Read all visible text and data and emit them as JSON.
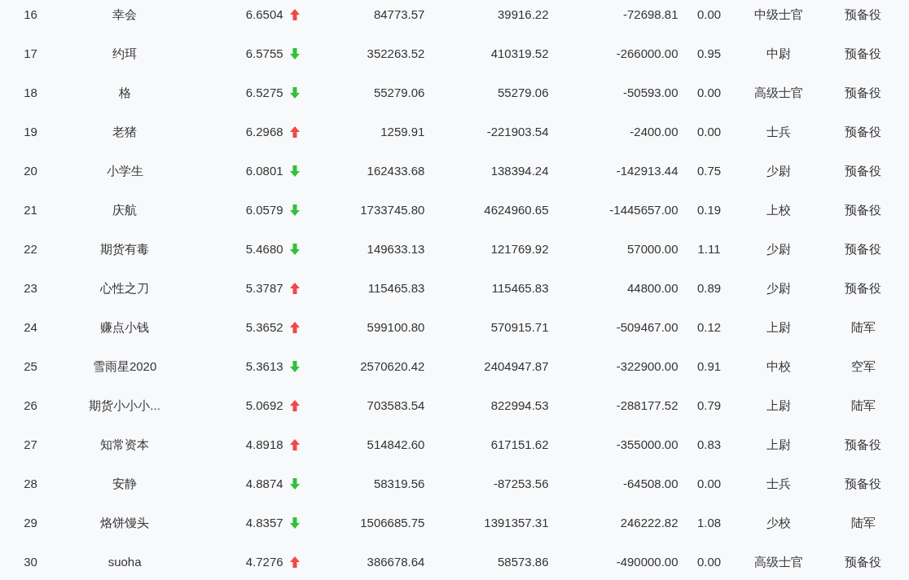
{
  "rows": [
    {
      "rank": "16",
      "name": "幸会",
      "score": "6.6504",
      "rising": true,
      "column_5": "84773.57",
      "column_6": "39916.22",
      "column_7": "-72698.81",
      "column_8": "0.00",
      "column_9": "中级士官",
      "column_10": "预备役"
    },
    {
      "rank": "17",
      "name": "约珥",
      "score": "6.5755",
      "rising": false,
      "column_5": "352263.52",
      "column_6": "410319.52",
      "column_7": "-266000.00",
      "column_8": "0.95",
      "column_9": "中尉",
      "column_10": "预备役"
    },
    {
      "rank": "18",
      "name": "格",
      "score": "6.5275",
      "rising": false,
      "column_5": "55279.06",
      "column_6": "55279.06",
      "column_7": "-50593.00",
      "column_8": "0.00",
      "column_9": "高级士官",
      "column_10": "预备役"
    },
    {
      "rank": "19",
      "name": "老猪",
      "score": "6.2968",
      "rising": true,
      "column_5": "1259.91",
      "column_6": "-221903.54",
      "column_7": "-2400.00",
      "column_8": "0.00",
      "column_9": "士兵",
      "column_10": "预备役"
    },
    {
      "rank": "20",
      "name": "小学生",
      "score": "6.0801",
      "rising": false,
      "column_5": "162433.68",
      "column_6": "138394.24",
      "column_7": "-142913.44",
      "column_8": "0.75",
      "column_9": "少尉",
      "column_10": "预备役"
    },
    {
      "rank": "21",
      "name": "庆航",
      "score": "6.0579",
      "rising": false,
      "column_5": "1733745.80",
      "column_6": "4624960.65",
      "column_7": "-1445657.00",
      "column_8": "0.19",
      "column_9": "上校",
      "column_10": "预备役"
    },
    {
      "rank": "22",
      "name": "期货有毒",
      "score": "5.4680",
      "rising": false,
      "column_5": "149633.13",
      "column_6": "121769.92",
      "column_7": "57000.00",
      "column_8": "1.11",
      "column_9": "少尉",
      "column_10": "预备役"
    },
    {
      "rank": "23",
      "name": "心性之刀",
      "score": "5.3787",
      "rising": true,
      "column_5": "115465.83",
      "column_6": "115465.83",
      "column_7": "44800.00",
      "column_8": "0.89",
      "column_9": "少尉",
      "column_10": "预备役"
    },
    {
      "rank": "24",
      "name": "赚点小钱",
      "score": "5.3652",
      "rising": true,
      "column_5": "599100.80",
      "column_6": "570915.71",
      "column_7": "-509467.00",
      "column_8": "0.12",
      "column_9": "上尉",
      "column_10": "陆军"
    },
    {
      "rank": "25",
      "name": "雪雨星2020",
      "score": "5.3613",
      "rising": false,
      "column_5": "2570620.42",
      "column_6": "2404947.87",
      "column_7": "-322900.00",
      "column_8": "0.91",
      "column_9": "中校",
      "column_10": "空军"
    },
    {
      "rank": "26",
      "name": "期货小小小...",
      "score": "5.0692",
      "rising": true,
      "column_5": "703583.54",
      "column_6": "822994.53",
      "column_7": "-288177.52",
      "column_8": "0.79",
      "column_9": "上尉",
      "column_10": "陆军"
    },
    {
      "rank": "27",
      "name": "知常资本",
      "score": "4.8918",
      "rising": true,
      "column_5": "514842.60",
      "column_6": "617151.62",
      "column_7": "-355000.00",
      "column_8": "0.83",
      "column_9": "上尉",
      "column_10": "预备役"
    },
    {
      "rank": "28",
      "name": "安静",
      "score": "4.8874",
      "rising": false,
      "column_5": "58319.56",
      "column_6": "-87253.56",
      "column_7": "-64508.00",
      "column_8": "0.00",
      "column_9": "士兵",
      "column_10": "预备役"
    },
    {
      "rank": "29",
      "name": "烙饼馒头",
      "score": "4.8357",
      "rising": false,
      "column_5": "1506685.75",
      "column_6": "1391357.31",
      "column_7": "246222.82",
      "column_8": "1.08",
      "column_9": "少校",
      "column_10": "陆军"
    },
    {
      "rank": "30",
      "name": "suoha",
      "score": "4.7276",
      "rising": true,
      "column_5": "386678.64",
      "column_6": "58573.86",
      "column_7": "-490000.00",
      "column_8": "0.00",
      "column_9": "高级士官",
      "column_10": "预备役"
    }
  ]
}
